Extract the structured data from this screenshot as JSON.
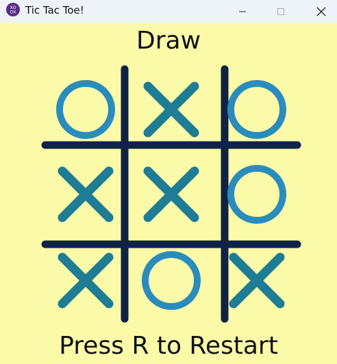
{
  "window": {
    "title": "Tic Tac Toe!",
    "icon": "tic-tac-toe-app-icon",
    "controls": [
      "minimize-icon",
      "maximize-icon",
      "close-icon"
    ]
  },
  "game": {
    "status": "Draw",
    "prompt": "Press R to Restart",
    "board": [
      [
        "O",
        "X",
        "O"
      ],
      [
        "X",
        "X",
        "O"
      ],
      [
        "X",
        "O",
        "X"
      ]
    ]
  },
  "colors": {
    "background": "#fbfaa8",
    "grid": "#0f2347",
    "x_mark": "#1e7c94",
    "o_mark": "#2a8cbc",
    "titlebar": "#eef3fa",
    "app_icon": "#5b2a86"
  }
}
